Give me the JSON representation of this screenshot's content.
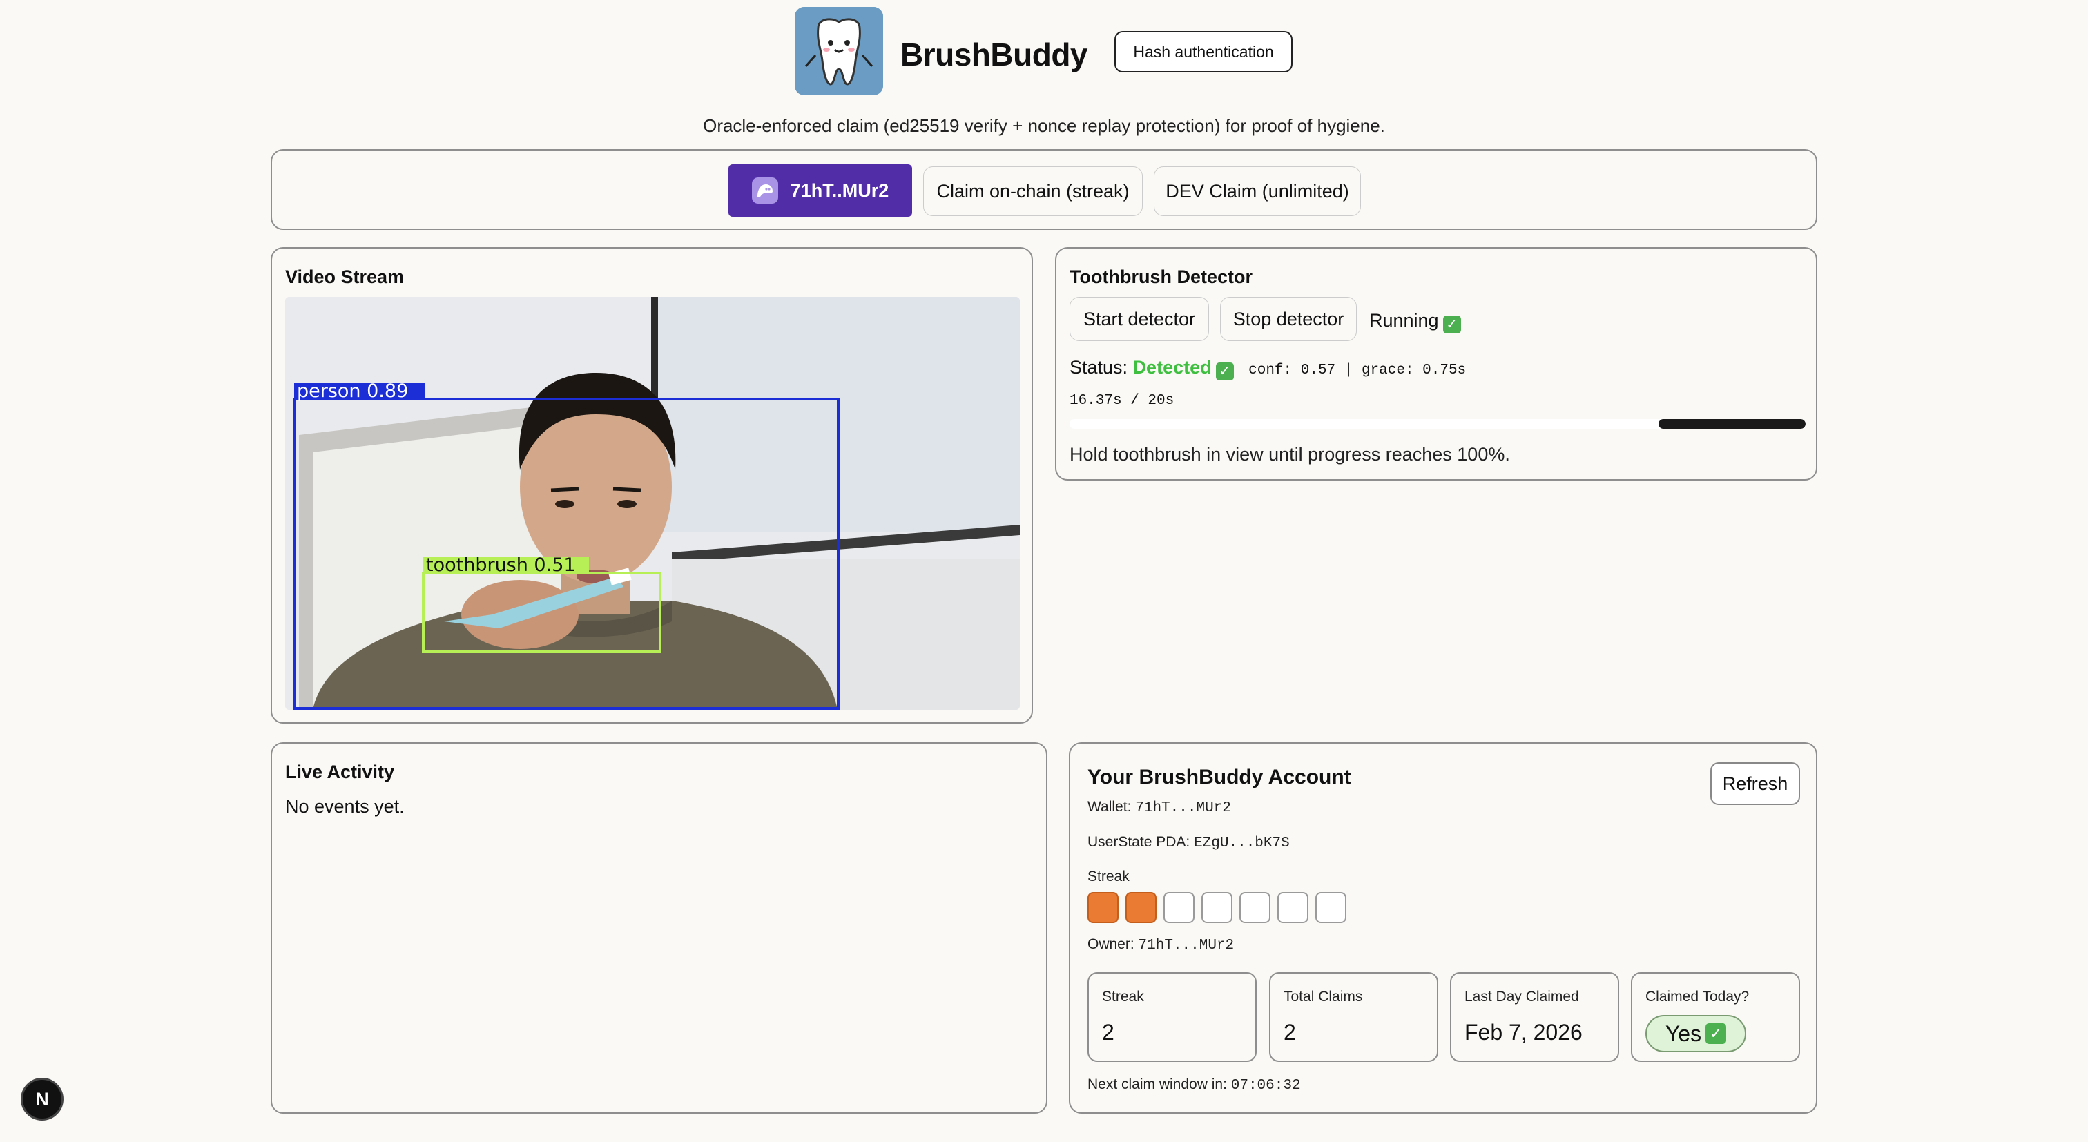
{
  "header": {
    "brand": "BrushBuddy",
    "hash_button": "Hash authentication",
    "subtitle": "Oracle-enforced claim (ed25519 verify + nonce replay protection) for proof of hygiene."
  },
  "toolbar": {
    "wallet_label": "71hT..MUr2",
    "claim_label": "Claim on-chain (streak)",
    "dev_label": "DEV Claim (unlimited)"
  },
  "video": {
    "title": "Video Stream",
    "detections": [
      {
        "label": "person 0.89",
        "color": "#1c2fd6"
      },
      {
        "label": "toothbrush 0.51",
        "color": "#b6f056"
      }
    ]
  },
  "detector": {
    "title": "Toothbrush Detector",
    "start_label": "Start detector",
    "stop_label": "Stop detector",
    "running_label": "Running",
    "status_prefix": "Status:",
    "status_value": "Detected",
    "conf_text": "conf: 0.57 | grace: 0.75s",
    "timer_text": "16.37s / 20s",
    "progress_fraction": 0.2,
    "hint": "Hold toothbrush in view until progress reaches 100%."
  },
  "activity": {
    "title": "Live Activity",
    "empty_text": "No events yet."
  },
  "account": {
    "title": "Your BrushBuddy Account",
    "refresh_label": "Refresh",
    "wallet_prefix": "Wallet:",
    "wallet_value": "71hT...MUr2",
    "pda_prefix": "UserState PDA:",
    "pda_value": "EZgU...bK7S",
    "streak_heading": "Streak",
    "streak_days": [
      true,
      true,
      false,
      false,
      false,
      false,
      false
    ],
    "owner_prefix": "Owner:",
    "owner_value": "71hT...MUr2",
    "stats": [
      {
        "label": "Streak",
        "value": "2"
      },
      {
        "label": "Total Claims",
        "value": "2"
      },
      {
        "label": "Last Day Claimed",
        "value": "Feb 7, 2026"
      },
      {
        "label": "Claimed Today?",
        "value": "Yes"
      }
    ],
    "next_prefix": "Next claim window in:",
    "next_value": "07:06:32"
  },
  "dev_badge": "N",
  "colors": {
    "accent": "#512da8",
    "streak_on": "#ea7b33",
    "detected": "#3fbf3f"
  }
}
